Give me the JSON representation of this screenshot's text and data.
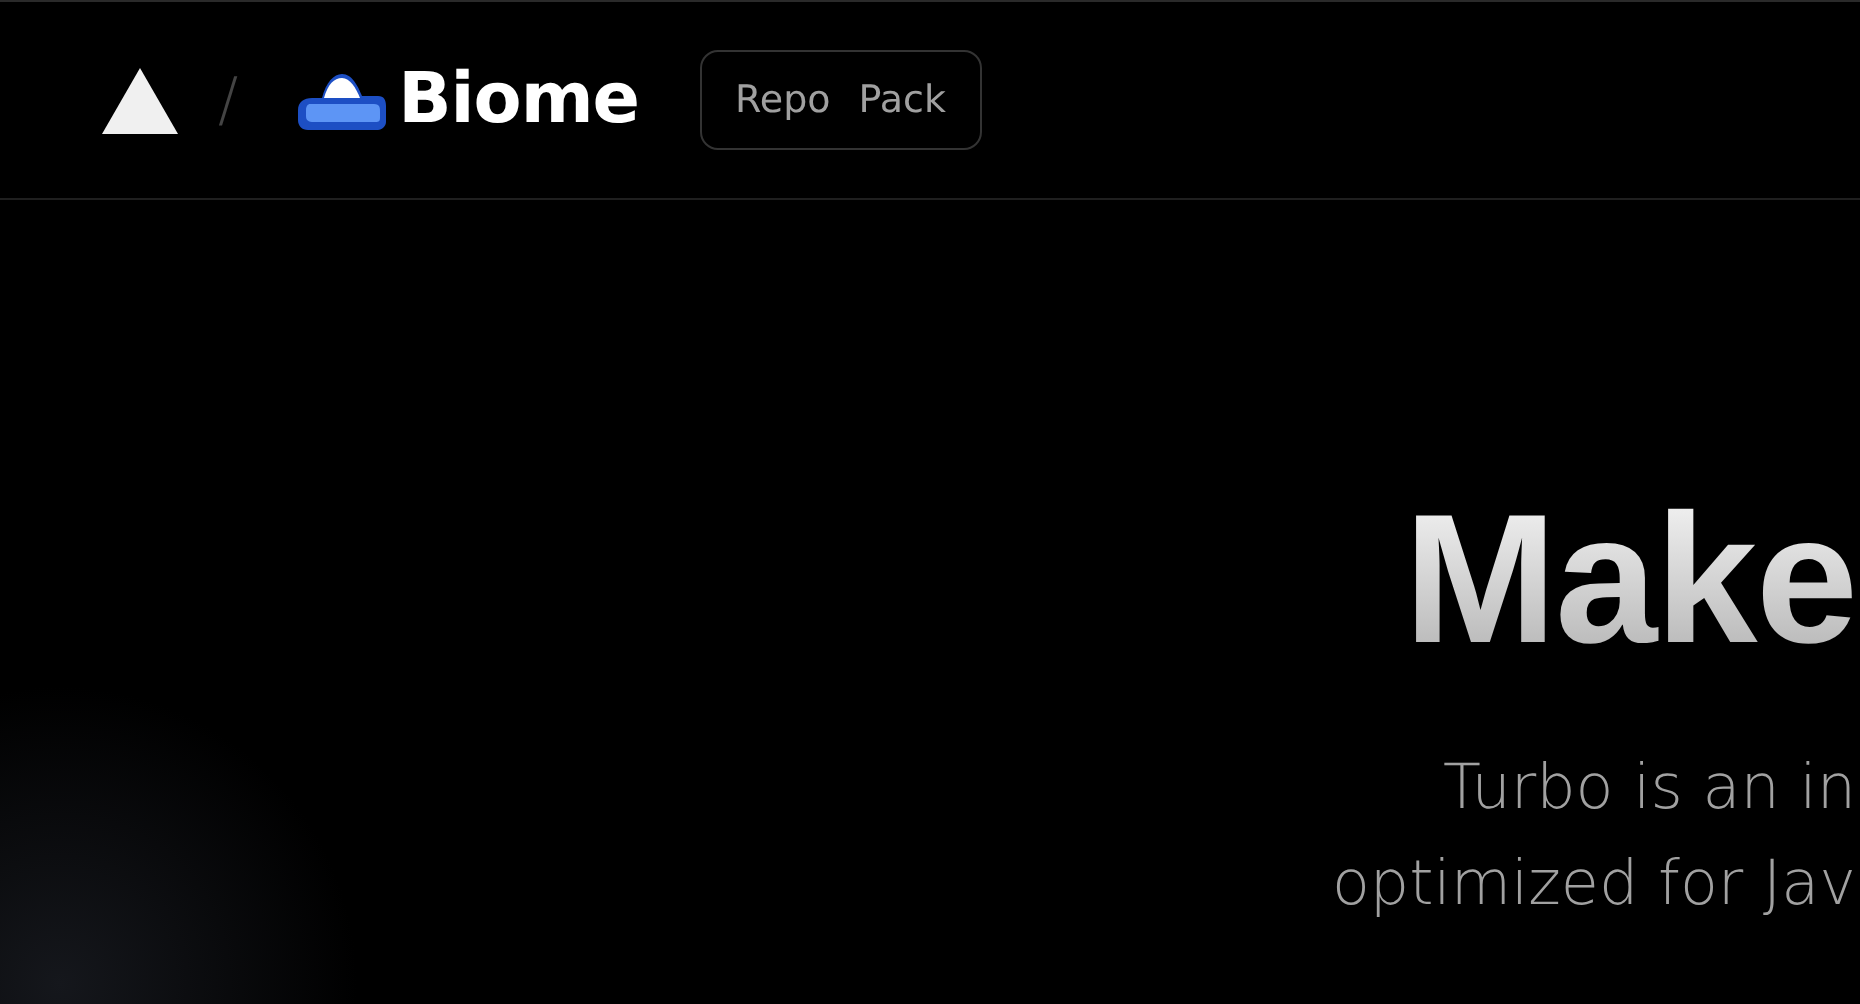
{
  "header": {
    "separator": "/",
    "brand": "Biome",
    "switcher": [
      {
        "label": "Repo",
        "selected": false
      },
      {
        "label": "Pack",
        "selected": false
      }
    ]
  },
  "hero": {
    "title": "Make",
    "subtitle_lines": [
      "Turbo is an in",
      "optimized for Jav"
    ]
  }
}
